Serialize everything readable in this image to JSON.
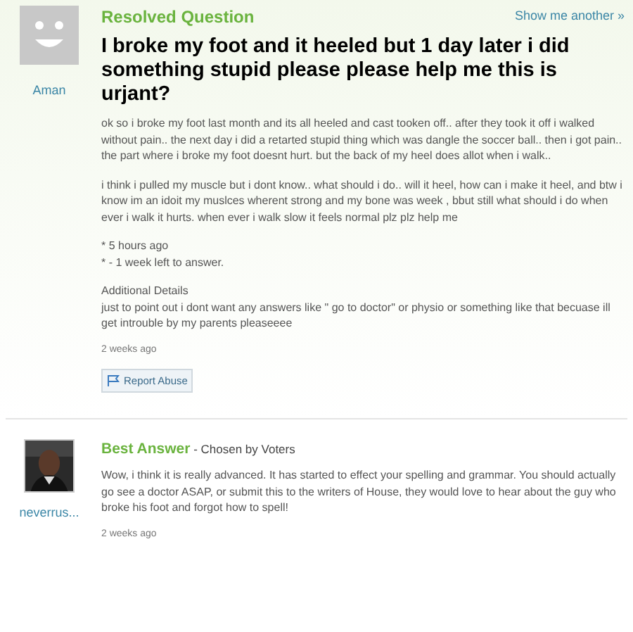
{
  "question": {
    "status": "Resolved Question",
    "show_another": "Show me another »",
    "asker": "Aman",
    "title": "I broke my foot and it heeled but 1 day later i did something stupid please please help me this is urjant?",
    "paragraphs": [
      "ok so i broke my foot last month and its all heeled and cast tooken off.. after they took it off i walked without pain.. the next day i did a retarted stupid thing which was dangle the soccer ball.. then i got pain.. the part where i broke my foot doesnt hurt. but the back of my heel does allot when i walk..",
      "i think i pulled my muscle but i dont know.. what should i do.. will it heel, how can i make it heel, and btw i know im an idoit my muslces wherent strong and my bone was week , bbut still what should i do when ever i walk it hurts. when ever i walk slow it feels normal plz plz help me"
    ],
    "meta": [
      "* 5 hours ago",
      "* - 1 week left to answer."
    ],
    "details_heading": "Additional Details",
    "details": "just to point out i dont want any answers like \" go to doctor\" or physio or something like that becuase ill get introuble by my parents pleaseeee",
    "time": "2 weeks ago",
    "report": "Report Abuse"
  },
  "answer": {
    "answerer": "neverrus...",
    "label": "Best Answer",
    "chosen": " - Chosen by Voters",
    "text": "Wow, i think it is really advanced. It has started to effect your spelling and grammar. You should actually go see a doctor ASAP, or submit this to the writers of House, they would love to hear about the guy who broke his foot and forgot how to spell!",
    "time": "2 weeks ago"
  }
}
